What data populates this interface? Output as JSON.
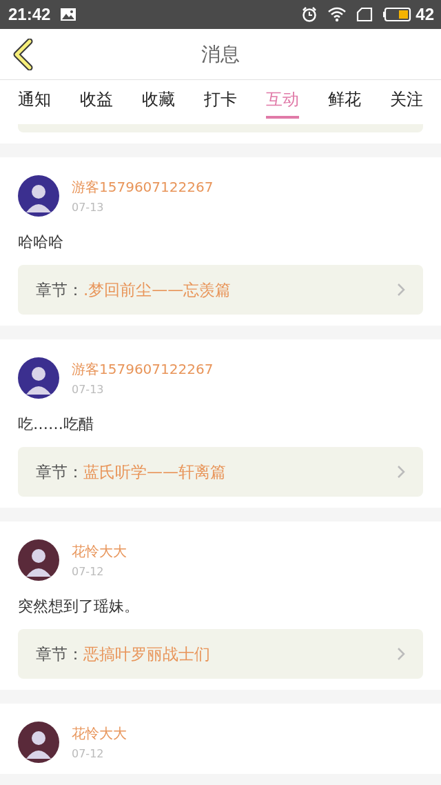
{
  "status_bar": {
    "time": "21:42",
    "battery": "42"
  },
  "header": {
    "title": "消息"
  },
  "tabs": [
    {
      "label": "通知",
      "selected": false
    },
    {
      "label": "收益",
      "selected": false
    },
    {
      "label": "收藏",
      "selected": false
    },
    {
      "label": "打卡",
      "selected": false
    },
    {
      "label": "互动",
      "selected": true
    },
    {
      "label": "鲜花",
      "selected": false
    },
    {
      "label": "关注",
      "selected": false
    }
  ],
  "posts": [
    {
      "user": "游客1579607122267",
      "date": "07-13",
      "color": "#3b2f8f",
      "comment": "哈哈哈",
      "chapter_label": "章节：",
      "chapter": ".梦回前尘——忘羡篇"
    },
    {
      "user": "游客1579607122267",
      "date": "07-13",
      "color": "#3b2f8f",
      "comment": "吃……吃醋",
      "chapter_label": "章节：",
      "chapter": "蓝氏听学——轩离篇"
    },
    {
      "user": "花怜大大",
      "date": "07-12",
      "color": "#5a2a3a",
      "comment": "突然想到了瑶妹。",
      "chapter_label": "章节：",
      "chapter": "恶搞叶罗丽战士们"
    },
    {
      "user": "花怜大大",
      "date": "07-12",
      "color": "#5a2a3a"
    }
  ]
}
